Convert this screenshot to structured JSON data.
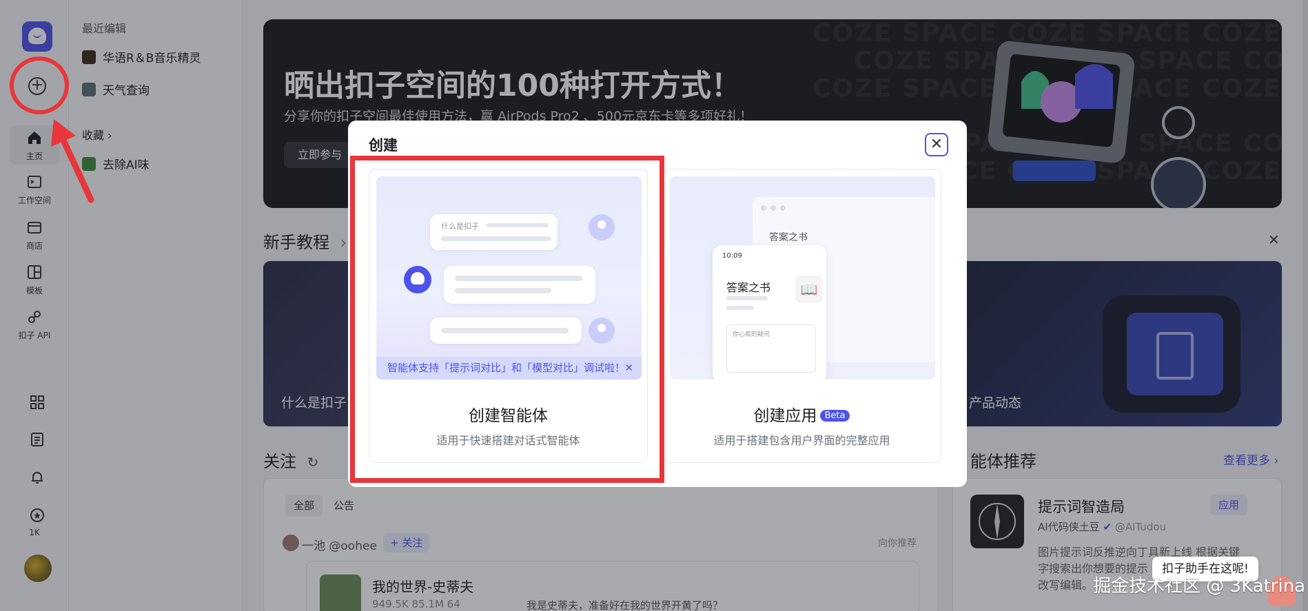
{
  "rail": {
    "items": [
      {
        "label": "主页",
        "icon": "home-icon"
      },
      {
        "label": "工作空间",
        "icon": "terminal-icon"
      },
      {
        "label": "商店",
        "icon": "store-icon"
      },
      {
        "label": "模板",
        "icon": "template-icon"
      },
      {
        "label": "扣子 API",
        "icon": "api-icon"
      }
    ],
    "credits": "1K",
    "create_icon": "plus-circle-icon"
  },
  "sidebar": {
    "recent_heading": "最近编辑",
    "recent": [
      {
        "label": "华语R＆B音乐精灵"
      },
      {
        "label": "天气查询"
      }
    ],
    "favorites_heading": "收藏 ›",
    "favorites": [
      {
        "label": "去除AI味"
      }
    ]
  },
  "banner": {
    "title": "晒出扣子空间的100种打开方式！",
    "subtitle": "分享你的扣子空间最佳使用方法，赢 AirPods Pro2 、500元京东卡等多项好礼！",
    "button": "立即参与",
    "watermark": "COZE SPACE COZE SPACE COZE"
  },
  "tutorial": {
    "title": "新手教程",
    "arrow": "›",
    "cards": [
      {
        "label": "什么是扣子"
      },
      {
        "label": "产品动态"
      }
    ]
  },
  "follow": {
    "title": "关注",
    "tabs": [
      "全部",
      "公告"
    ],
    "author": "一池 @oohee",
    "follow_btn": "+ 关注",
    "recommend": "向你推荐",
    "post_title": "我的世界-史蒂夫",
    "post_stats": "949.5K   85.1M   64",
    "post_text": "我是史蒂夫，准备好在我的世界开黄了吗？"
  },
  "agents": {
    "title": "能体推荐",
    "more": "查看更多 ›",
    "item_title": "提示词智造局",
    "item_badge": "应用",
    "item_author": "AI代码侠土豆",
    "item_handle": "@AITudou",
    "item_desc_1": "图片提示词反推逆向丁具新上线 根据关键",
    "item_desc_2": "字搜索出你想要的提示",
    "item_desc_3": "改写编辑。"
  },
  "modal": {
    "title": "创建",
    "close": "✕",
    "options": [
      {
        "title": "创建智能体",
        "desc": "适用于快速搭建对话式智能体",
        "preview_bubble": "什么是扣子",
        "notice": "智能体支持「提示词对比」和「模型对比」调试啦！",
        "notice_close": "✕"
      },
      {
        "title": "创建应用",
        "badge": "Beta",
        "desc": "适用于搭建包含用户界面的完整应用",
        "preview_app": "答案之书",
        "preview_time": "10:09",
        "preview_input": "你心底的疑问",
        "preview_icon": "book-icon"
      }
    ]
  },
  "helper": "扣子助手在这呢!",
  "watermark": "掘金技术社区 @ 3Katrina",
  "colors": {
    "accent": "#4d53e8",
    "annotation": "#e8363a",
    "banner_bg": "#1b1c20"
  }
}
